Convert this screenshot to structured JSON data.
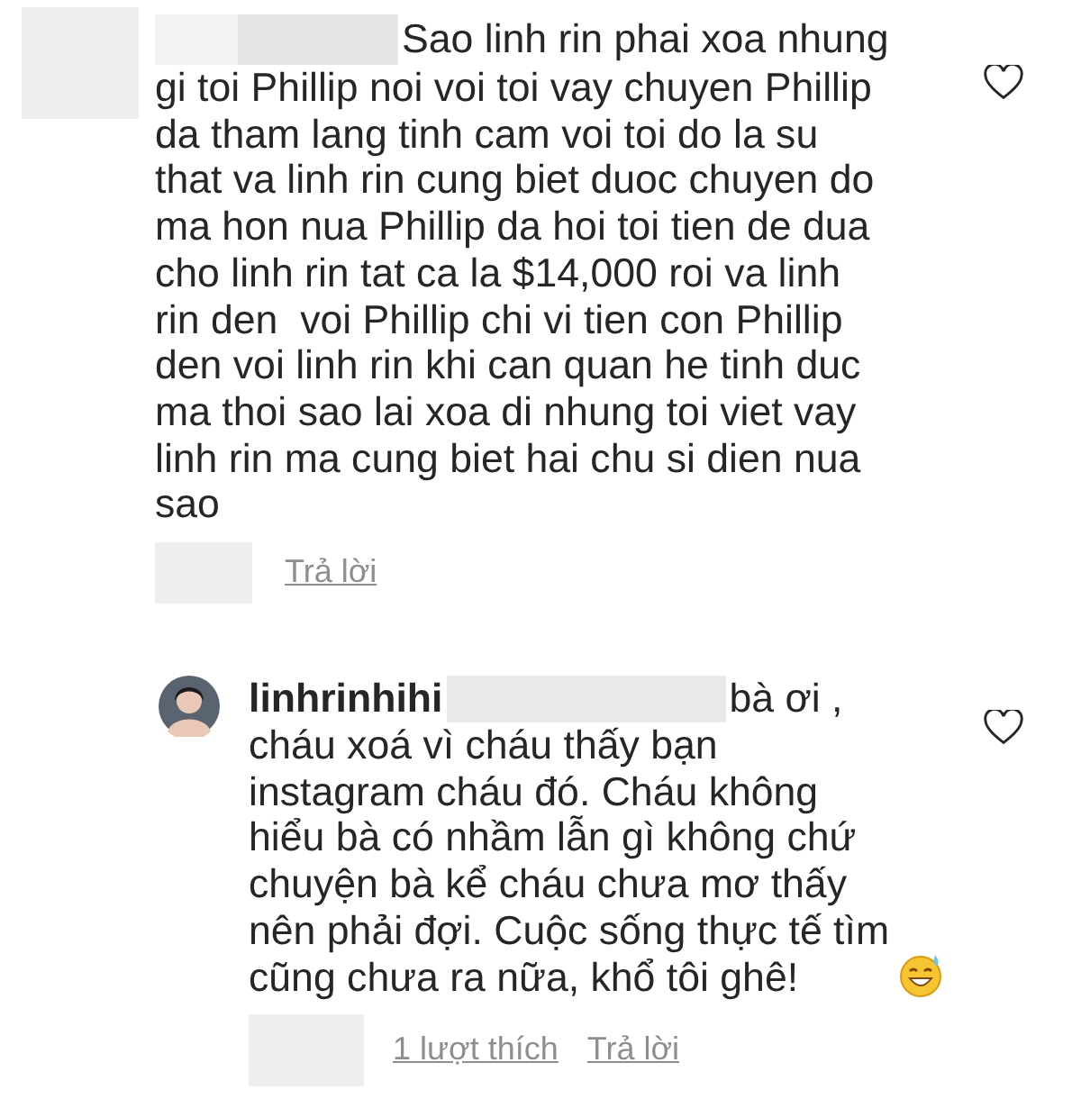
{
  "comments": [
    {
      "avatar": {
        "kind": "redacted"
      },
      "first_line": "Sao linh rin phai xoa nhung",
      "lines": [
        "gi toi Phillip noi voi toi vay chuyen Phillip",
        "da tham lang tinh cam voi toi do la su",
        "that va linh rin cung biet duoc chuyen do",
        "ma hon nua Phillip da hoi toi tien de dua",
        "cho linh rin tat ca la $14,000 roi va linh",
        "rin den  voi Phillip chi vi tien con Phillip",
        "den voi linh rin khi can quan he tinh duc",
        "ma thoi sao lai xoa di nhung toi viet vay",
        "linh rin ma cung biet hai chu si dien nua",
        "sao"
      ],
      "emoji": false,
      "liked": false,
      "reply": "Trả lời"
    },
    {
      "avatar": {
        "kind": "photo"
      },
      "username": "linhrinhihi",
      "first_line": "bà ơi ,",
      "lines": [
        "cháu xoá vì cháu thấy bạn",
        "instagram cháu đó. Cháu không",
        "hiểu bà có nhầm lẫn gì không chứ",
        "chuyện bà kể cháu chưa mơ thấy",
        "nên phải đợi. Cuộc sống thực tế tìm",
        "cũng chưa ra nữa, khổ tôi ghê!"
      ],
      "emoji": true,
      "liked": false,
      "likes": "1 lượt thích",
      "reply": "Trả lời"
    }
  ]
}
